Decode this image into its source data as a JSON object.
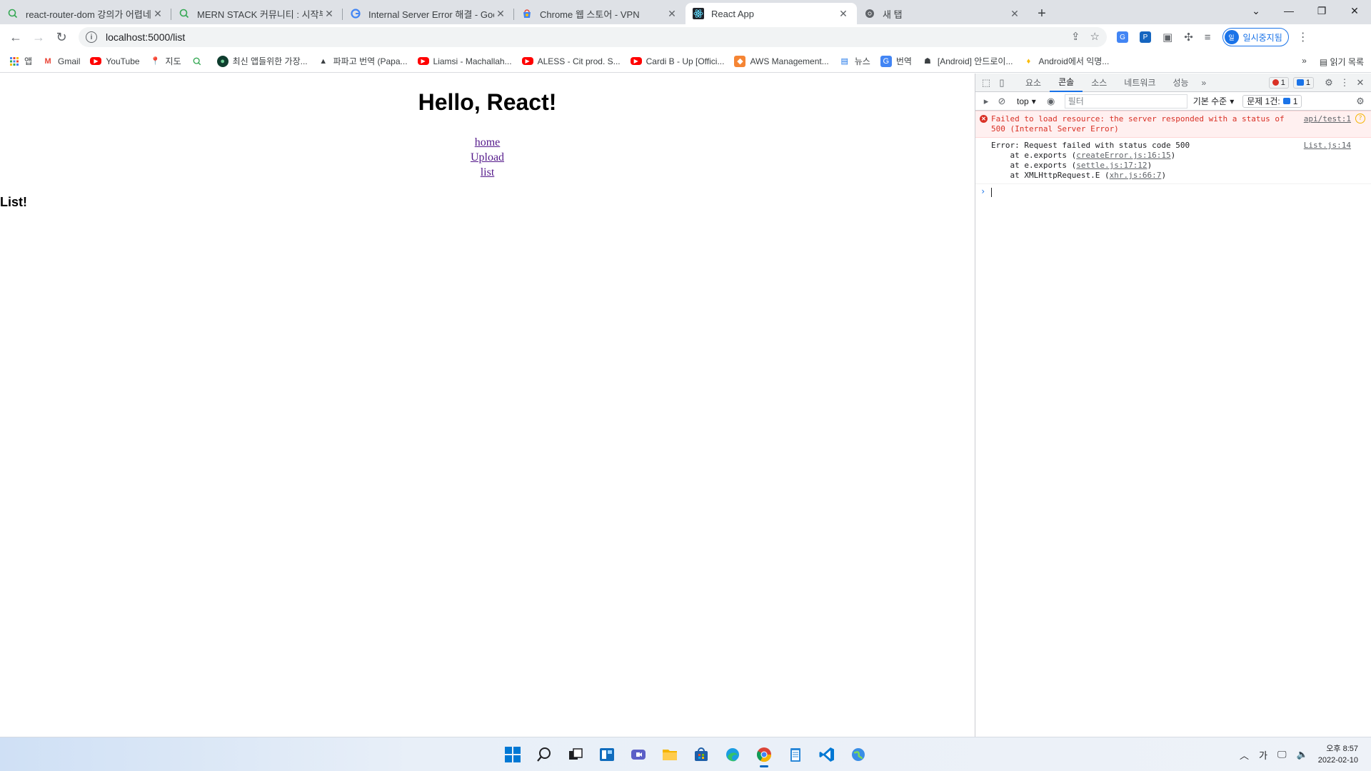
{
  "browser": {
    "tabs": [
      {
        "title": "react-router-dom 강의가 어렵네",
        "favicon": "inflearn-icon",
        "active": false
      },
      {
        "title": "MERN STACK 커뮤니티 : 시작부",
        "favicon": "inflearn-icon",
        "active": false
      },
      {
        "title": "Internal Server Error 해결 - Goo",
        "favicon": "google-icon",
        "active": false
      },
      {
        "title": "Chrome 웹 스토어 - VPN",
        "favicon": "webstore-icon",
        "active": false
      },
      {
        "title": "React App",
        "favicon": "react-icon",
        "active": true
      },
      {
        "title": "새 탭",
        "favicon": "chrome-icon",
        "active": false
      }
    ],
    "url": "localhost:5000/list",
    "profile_label": "일시중지됨",
    "bookmarks": [
      "앱",
      "Gmail",
      "YouTube",
      "지도",
      "",
      "최신 앱들위한 가장...",
      "파파고 번역 (Papa...",
      "Liamsi - Machallah...",
      "ALESS - Cit prod. S...",
      "Cardi B - Up [Offici...",
      "AWS Management...",
      "뉴스",
      "번역",
      "[Android] 안드로이...",
      "Android에서 익명..."
    ],
    "more_bookmarks": "»",
    "reading_list": "읽기 목록"
  },
  "page": {
    "heading": "Hello, React!",
    "links": [
      "home",
      "Upload",
      "list"
    ],
    "subheading": "List!"
  },
  "devtools": {
    "tabs": [
      "요소",
      "콘솔",
      "소스",
      "네트워크",
      "성능"
    ],
    "active_tab": "콘솔",
    "more": "»",
    "error_count": "1",
    "message_count": "1",
    "context": "top",
    "filter_placeholder": "필터",
    "level": "기본 수준",
    "issues_label": "문제 1건:",
    "issues_count": "1",
    "messages": {
      "error_text": "Failed to load resource: the server responded with a status of 500 (Internal Server Error)",
      "error_source": "api/test:1",
      "log_line": "Error: Request failed with status code 500",
      "log_source": "List.js:14",
      "stack": [
        {
          "prefix": "    at e.exports (",
          "link": "createError.js:16:15",
          "suffix": ")"
        },
        {
          "prefix": "    at e.exports (",
          "link": "settle.js:17:12",
          "suffix": ")"
        },
        {
          "prefix": "    at XMLHttpRequest.E (",
          "link": "xhr.js:66:7",
          "suffix": ")"
        }
      ]
    },
    "prompt": "›"
  },
  "taskbar": {
    "time": "오후 8:57",
    "date": "2022-02-10",
    "ime": "가"
  },
  "colors": {
    "accent": "#1a73e8",
    "error": "#d93025",
    "visited_link": "#551a8b"
  }
}
